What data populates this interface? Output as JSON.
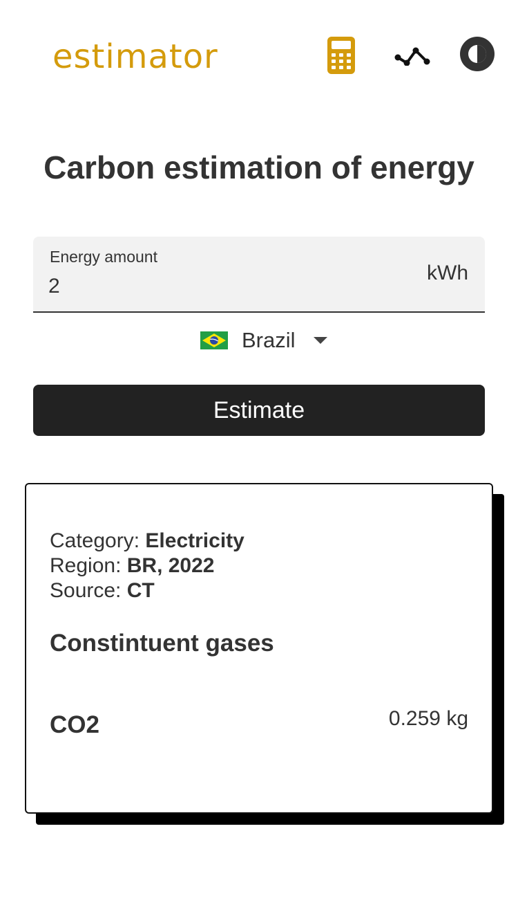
{
  "header": {
    "logo_text": "estimator",
    "nav": [
      {
        "icon": "calculator-icon",
        "color": "#d49b0c"
      },
      {
        "icon": "trend-line-icon",
        "color": "#111111"
      },
      {
        "icon": "theme-toggle-icon",
        "color": "#333333"
      }
    ]
  },
  "main": {
    "title": "Carbon estimation of energy"
  },
  "form": {
    "energy_label": "Energy amount",
    "energy_value": "2",
    "energy_unit": "kWh",
    "country_flag_icon": "brazil-flag-icon",
    "country_name": "Brazil",
    "estimate_label": "Estimate"
  },
  "result": {
    "category_label": "Category:",
    "category_value": "Electricity",
    "region_label": "Region:",
    "region_value": "BR, 2022",
    "source_label": "Source:",
    "source_value": "CT",
    "gases_heading": "Constintuent gases",
    "gases": [
      {
        "name": "CO2",
        "value": "0.259 kg"
      }
    ]
  },
  "colors": {
    "brand": "#d49b0c",
    "button_bg": "#222222",
    "field_bg": "#f2f2f2",
    "text": "#333333"
  }
}
